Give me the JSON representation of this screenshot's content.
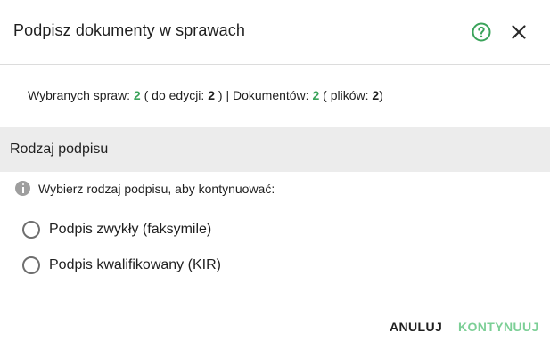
{
  "dialog": {
    "title": "Podpisz dokumenty w sprawach",
    "help_icon": "help-circle-icon",
    "close_icon": "close-icon",
    "accent_color": "#3aa35a"
  },
  "summary": {
    "cases_label": "Wybranych spraw: ",
    "cases_count": "2",
    "to_edit_prefix": " (  do edycji: ",
    "to_edit_count": "2",
    "to_edit_suffix": " ) |  Dokumentów: ",
    "documents_count": "2",
    "files_prefix": " (  plików: ",
    "files_count": "2",
    "files_suffix": ")"
  },
  "section": {
    "title": "Rodzaj podpisu",
    "info_icon": "info-icon",
    "info_text": "Wybierz rodzaj podpisu, aby kontynuować:"
  },
  "options": [
    {
      "label": "Podpis zwykły (faksymile)",
      "selected": false
    },
    {
      "label": "Podpis kwalifikowany (KIR)",
      "selected": false
    }
  ],
  "actions": {
    "cancel_label": "ANULUJ",
    "continue_label": "KONTYNUUJ"
  }
}
